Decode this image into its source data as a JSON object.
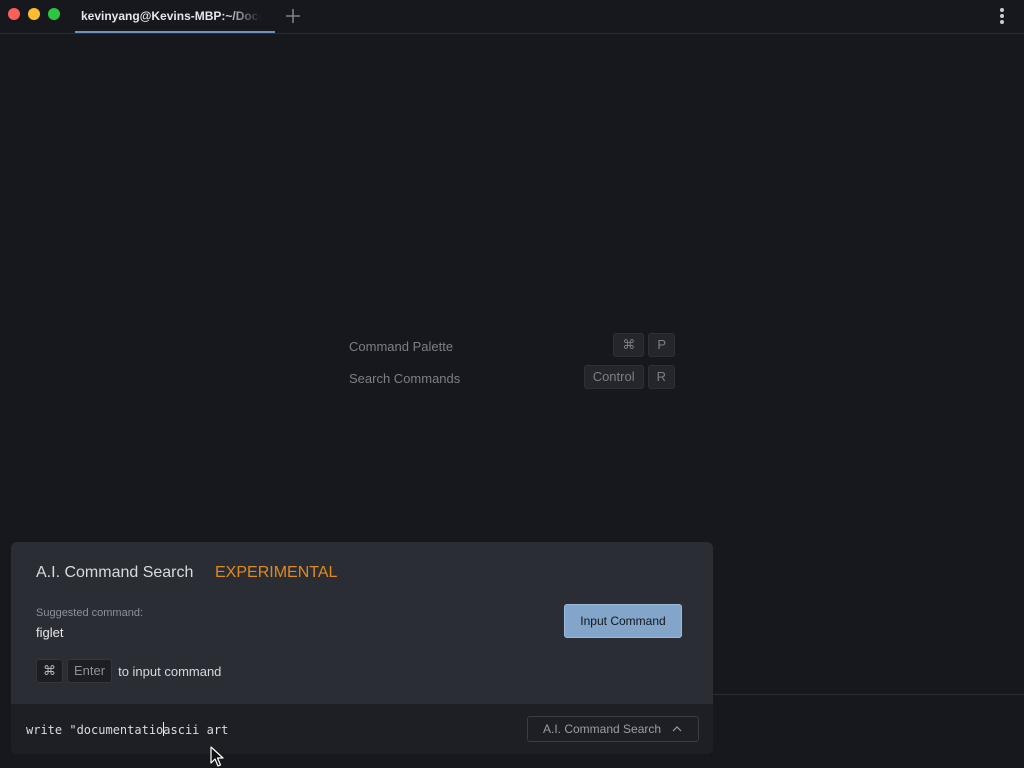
{
  "window": {
    "traffic_lights": [
      "close",
      "minimize",
      "zoom"
    ],
    "colors": {
      "close": "#fe5f57",
      "minimize": "#febc2e",
      "zoom": "#29c840"
    }
  },
  "tabs": [
    {
      "label": "kevinyang@Kevins-MBP:~/Docu",
      "active": true
    }
  ],
  "tabbar": {
    "new_tab_icon": "plus-icon",
    "menu_icon": "kebab-menu-icon"
  },
  "shortcuts_hint": [
    {
      "label": "Command Palette",
      "keys": [
        "⌘",
        "P"
      ]
    },
    {
      "label": "Search Commands",
      "keys": [
        "Control",
        "R"
      ]
    }
  ],
  "ai_panel": {
    "title": "A.I. Command Search",
    "badge": "EXPERIMENTAL",
    "badge_color": "#e08a1e",
    "suggested_label": "Suggested command:",
    "suggested_value": "figlet",
    "input_button_label": "Input Command",
    "input_button_color": "#82a5c9",
    "shortcut_keys": [
      "⌘",
      "Enter"
    ],
    "shortcut_text": "to input command",
    "input_text_before_caret": "write \"documentatio",
    "input_text_after_caret": "ascii art",
    "mode_label": "A.I. Command Search",
    "mode_icon": "chevron-up-icon"
  }
}
